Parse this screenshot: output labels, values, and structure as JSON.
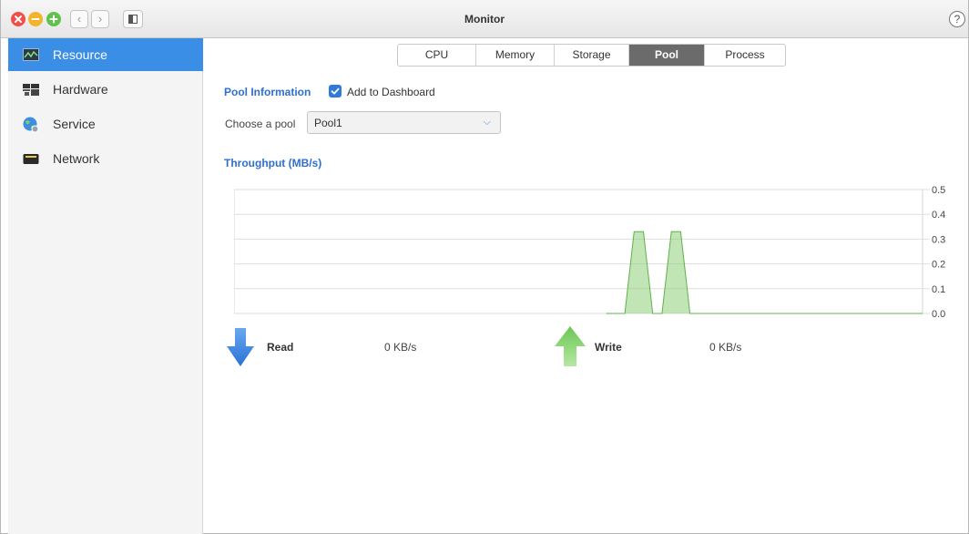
{
  "window": {
    "title": "Monitor",
    "help_label": "?"
  },
  "sidebar": {
    "items": [
      {
        "label": "Resource",
        "icon": "resource-monitor-icon",
        "active": true
      },
      {
        "label": "Hardware",
        "icon": "hardware-icon",
        "active": false
      },
      {
        "label": "Service",
        "icon": "service-globe-icon",
        "active": false
      },
      {
        "label": "Network",
        "icon": "network-icon",
        "active": false
      }
    ]
  },
  "tabs": [
    {
      "label": "CPU",
      "active": false
    },
    {
      "label": "Memory",
      "active": false
    },
    {
      "label": "Storage",
      "active": false
    },
    {
      "label": "Pool",
      "active": true
    },
    {
      "label": "Process",
      "active": false
    }
  ],
  "pool_info": {
    "title": "Pool Information",
    "add_to_dashboard": {
      "label": "Add to Dashboard",
      "checked": true
    },
    "choose_label": "Choose a pool",
    "selected_pool": "Pool1"
  },
  "throughput": {
    "title": "Throughput (MB/s)"
  },
  "chart_data": {
    "type": "area",
    "title": "Throughput (MB/s)",
    "ylim": [
      0,
      0.5
    ],
    "yticks": [
      "0.0",
      "0.1",
      "0.2",
      "0.3",
      "0.4",
      "0.5"
    ],
    "grid": true,
    "series": [
      {
        "name": "Write",
        "color": "#8fd07a",
        "values": [
          0,
          0,
          0,
          0,
          0,
          0,
          0,
          0,
          0,
          0,
          0,
          0,
          0,
          0,
          0,
          0,
          0,
          0,
          0,
          0,
          0,
          0,
          0,
          0,
          0,
          0,
          0,
          0,
          0,
          0,
          0,
          0,
          0,
          0,
          0,
          0,
          0,
          0,
          0,
          0,
          0,
          0,
          0,
          0.33,
          0.33,
          0,
          0,
          0.33,
          0.33,
          0,
          0,
          0,
          0,
          0,
          0,
          0,
          0,
          0,
          0,
          0,
          0,
          0,
          0,
          0,
          0,
          0,
          0,
          0,
          0,
          0,
          0,
          0,
          0,
          0,
          0
        ]
      }
    ]
  },
  "legend": {
    "read": {
      "label": "Read",
      "value": "0 KB/s",
      "color": "#3a84e0"
    },
    "write": {
      "label": "Write",
      "value": "0 KB/s",
      "color": "#86d06b"
    }
  },
  "colors": {
    "accent": "#3a8ee6",
    "title_blue": "#2f6fcf"
  }
}
